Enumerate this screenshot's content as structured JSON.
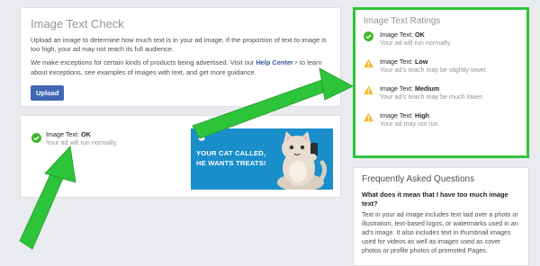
{
  "check": {
    "title": "Image Text Check",
    "desc": "Upload an image to determine how much text is in your ad image. If the proportion of text to image is too high, your ad may not reach its full audience.",
    "exceptions_pre": "We make exceptions for certain kinds of products being advertised. Visit our ",
    "help_link": "Help Center",
    "exceptions_post": " to learn about exceptions, see examples of images with text, and get more guidance.",
    "upload_label": "Upload"
  },
  "result": {
    "label": "Image Text: ",
    "level": "OK",
    "sub": "Your ad will run normally.",
    "ad_text_line1": "YOUR CAT CALLED,",
    "ad_text_line2": "HE WANTS TREATS!"
  },
  "ratings": {
    "title": "Image Text Ratings",
    "items": [
      {
        "label": "Image Text: ",
        "level": "OK",
        "sub": "Your ad will run normally.",
        "icon": "check-circle-icon"
      },
      {
        "label": "Image Text: ",
        "level": "Low",
        "sub": "Your ad's reach may be slightly lower.",
        "icon": "warning-icon"
      },
      {
        "label": "Image Text: ",
        "level": "Medium",
        "sub": "Your ad's reach may be much lower.",
        "icon": "warning-icon"
      },
      {
        "label": "Image Text: ",
        "level": "High",
        "sub": "Your ad may not run.",
        "icon": "warning-icon"
      }
    ]
  },
  "faq": {
    "title": "Frequently Asked Questions",
    "question": "What does it mean that I have too much image text?",
    "answer": "Text in your ad image includes text laid over a photo or illustration, text-based logos, or watermarks used in an ad's image. It also includes text in thumbnail images used for videos as well as images used as cover photos or profile photos of promoted Pages."
  },
  "colors": {
    "accent": "#4267b2",
    "ok_green": "#42b72a",
    "warning_yellow": "#f7b928",
    "highlight_green": "#2ec43a",
    "ad_blue": "#1a8ecb"
  }
}
